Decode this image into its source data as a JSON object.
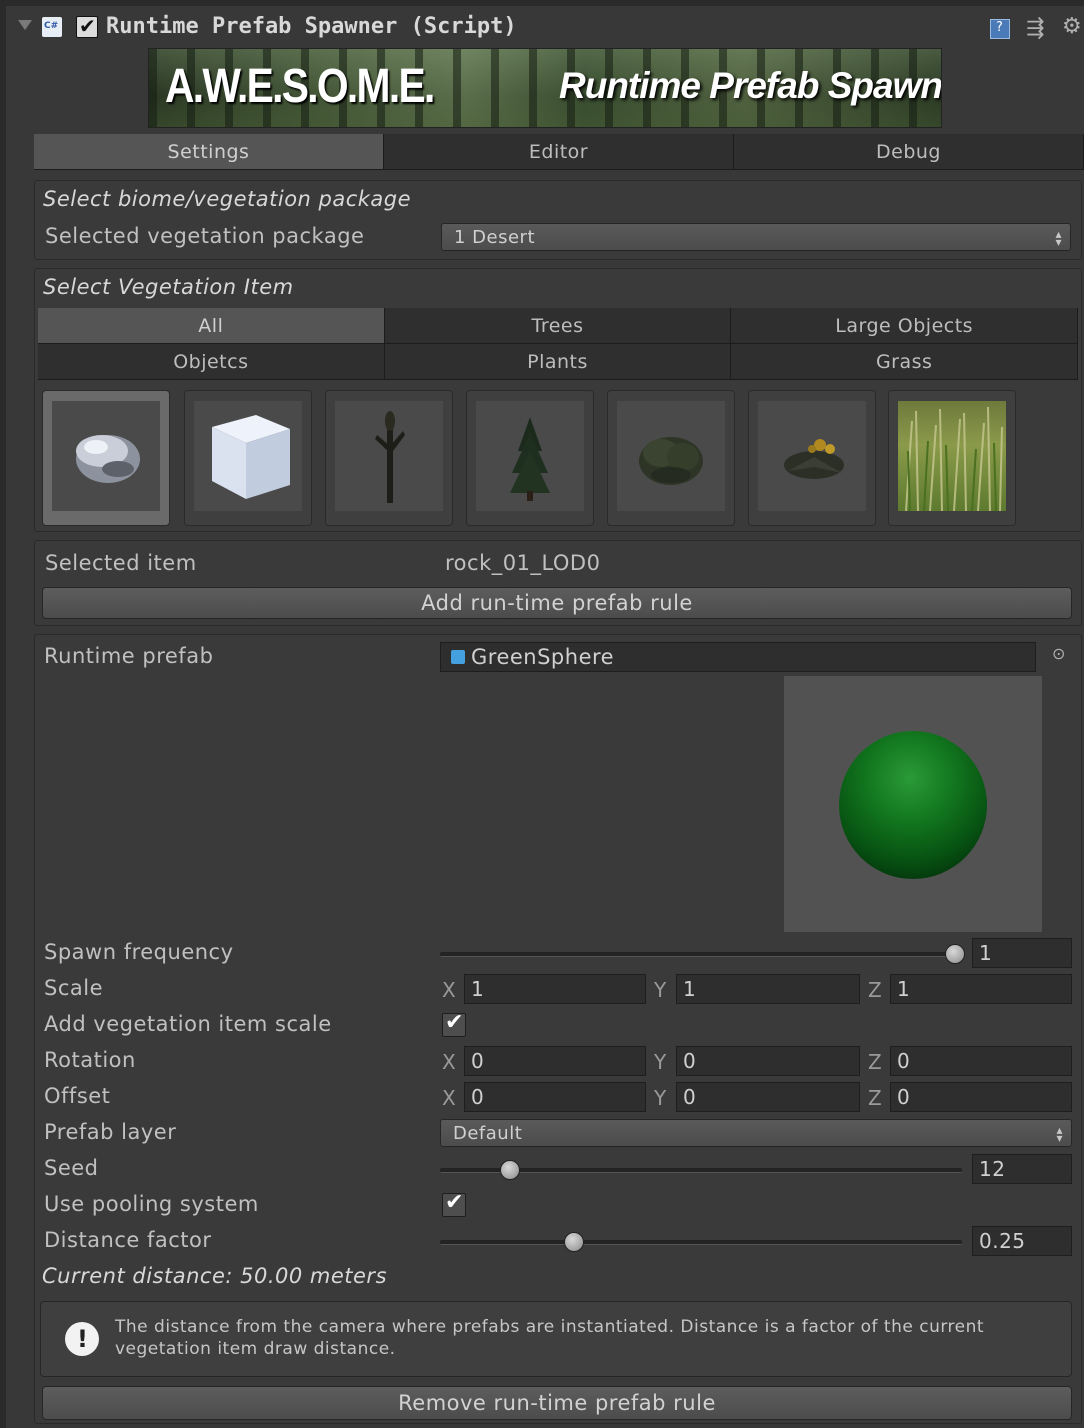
{
  "component": {
    "title": "Runtime Prefab Spawner (Script)",
    "enabled": true
  },
  "banner": {
    "logo_text": "A.W.E.S.O.M.E.",
    "subtitle": "Runtime Prefab Spawner"
  },
  "tabs": [
    {
      "label": "Settings",
      "active": true
    },
    {
      "label": "Editor",
      "active": false
    },
    {
      "label": "Debug",
      "active": false
    }
  ],
  "biome_section": {
    "title": "Select biome/vegetation package",
    "package_label": "Selected vegetation package",
    "package_value": "1 Desert"
  },
  "vegetation_section": {
    "title": "Select Vegetation Item",
    "filters_row1": [
      "All",
      "Trees",
      "Large Objects"
    ],
    "filters_row2": [
      "Objetcs",
      "Plants",
      "Grass"
    ],
    "active_filter": "All",
    "thumbnails": [
      "rock",
      "cube",
      "dead-tree",
      "pine-tree",
      "bush",
      "flower-plant",
      "grass-patch"
    ]
  },
  "selection": {
    "selected_label": "Selected item",
    "selected_value": "rock_01_LOD0",
    "add_button": "Add run-time prefab rule"
  },
  "rule": {
    "prefab_label": "Runtime prefab",
    "prefab_value": "GreenSphere",
    "spawn_frequency_label": "Spawn frequency",
    "spawn_frequency_value": "1",
    "spawn_frequency_fraction": 1.0,
    "scale_label": "Scale",
    "scale": {
      "x": "1",
      "y": "1",
      "z": "1"
    },
    "add_scale_label": "Add vegetation item scale",
    "add_scale_checked": true,
    "rotation_label": "Rotation",
    "rotation": {
      "x": "0",
      "y": "0",
      "z": "0"
    },
    "offset_label": "Offset",
    "offset": {
      "x": "0",
      "y": "0",
      "z": "0"
    },
    "layer_label": "Prefab layer",
    "layer_value": "Default",
    "seed_label": "Seed",
    "seed_value": "12",
    "seed_fraction": 0.13,
    "pooling_label": "Use pooling system",
    "pooling_checked": true,
    "distance_label": "Distance factor",
    "distance_value": "0.25",
    "distance_fraction": 0.25,
    "current_distance": "Current distance: 50.00 meters",
    "help_text": "The distance from the camera where prefabs are instantiated. Distance is a factor of the current vegetation item draw distance.",
    "remove_button": "Remove run-time prefab rule"
  },
  "colors": {
    "background": "#383838",
    "sphere": "#0b6a17"
  }
}
